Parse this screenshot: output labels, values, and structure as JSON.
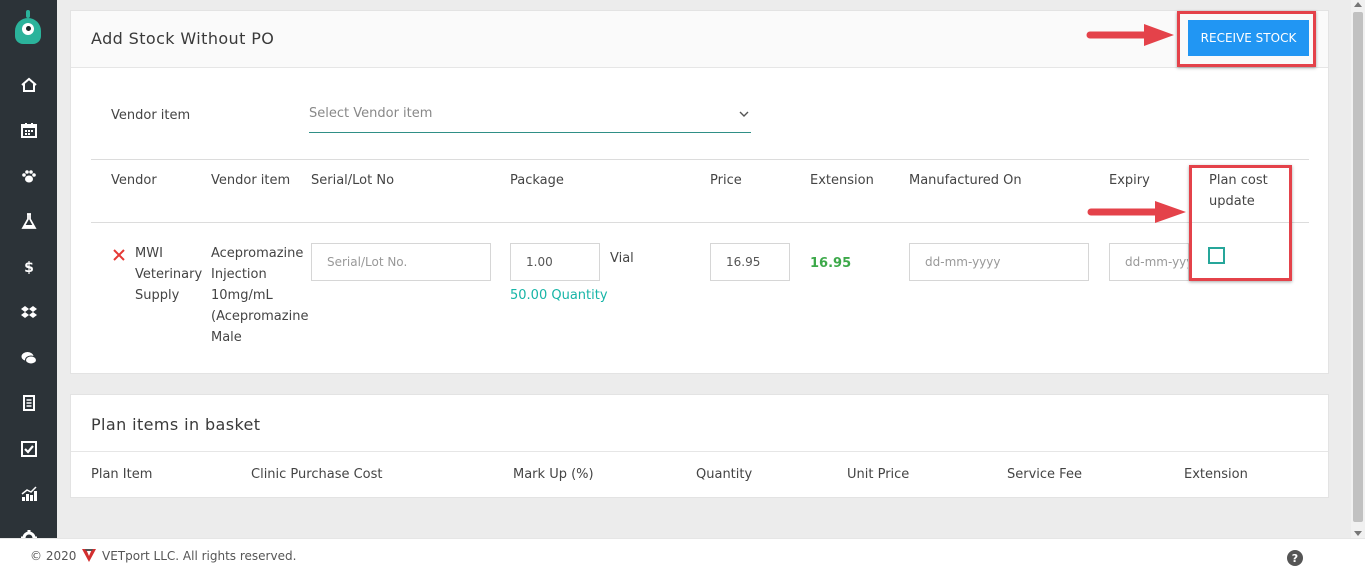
{
  "sidebar": {
    "logo": "monster-logo",
    "items": [
      {
        "name": "home",
        "icon": "home-icon"
      },
      {
        "name": "calendar",
        "icon": "calendar-icon"
      },
      {
        "name": "patients",
        "icon": "paw-icon"
      },
      {
        "name": "lab",
        "icon": "flask-icon"
      },
      {
        "name": "billing",
        "icon": "dollar-icon"
      },
      {
        "name": "inventory",
        "icon": "boxes-icon"
      },
      {
        "name": "messages",
        "icon": "chat-icon"
      },
      {
        "name": "reports",
        "icon": "document-icon"
      },
      {
        "name": "tasks",
        "icon": "checkbox-icon"
      },
      {
        "name": "analytics",
        "icon": "bar-chart-icon"
      },
      {
        "name": "settings",
        "icon": "gear-icon"
      }
    ]
  },
  "add_stock": {
    "title": "Add Stock Without PO",
    "receive_button": "RECEIVE STOCK",
    "vendor_item_label": "Vendor item",
    "vendor_item_placeholder": "Select Vendor item",
    "columns": {
      "vendor": "Vendor",
      "vendor_item": "Vendor item",
      "serial": "Serial/Lot No",
      "package": "Package",
      "price": "Price",
      "extension": "Extension",
      "manufactured": "Manufactured On",
      "expiry": "Expiry",
      "plan_cost_line1": "Plan cost",
      "plan_cost_line2": "update"
    },
    "row": {
      "vendor_lines": [
        "MWI",
        "Veterinary",
        "Supply"
      ],
      "item_lines": [
        "Acepromazine",
        "Injection",
        "10mg/mL",
        "(Acepromazine",
        "Male"
      ],
      "serial_placeholder": "Serial/Lot No.",
      "package_value": "1.00",
      "package_unit": "Vial",
      "quantity_text": "50.00 Quantity",
      "price_value": "16.95",
      "extension_value": "16.95",
      "manufactured_placeholder": "dd-mm-yyyy",
      "expiry_placeholder": "dd-mm-yyyy",
      "plan_cost_checked": false
    }
  },
  "basket": {
    "title": "Plan items in basket",
    "columns": [
      "Plan Item",
      "Clinic Purchase Cost",
      "Mark Up (%)",
      "Quantity",
      "Unit Price",
      "Service Fee",
      "Extension"
    ]
  },
  "footer": {
    "copyright": "© 2020",
    "company": "VETport LLC. All rights reserved.",
    "help": "?"
  },
  "colors": {
    "primary": "#2196f3",
    "highlight": "#e4424a",
    "teal": "#26a69a",
    "green": "#3da94a",
    "sidebar": "#2c3338"
  }
}
